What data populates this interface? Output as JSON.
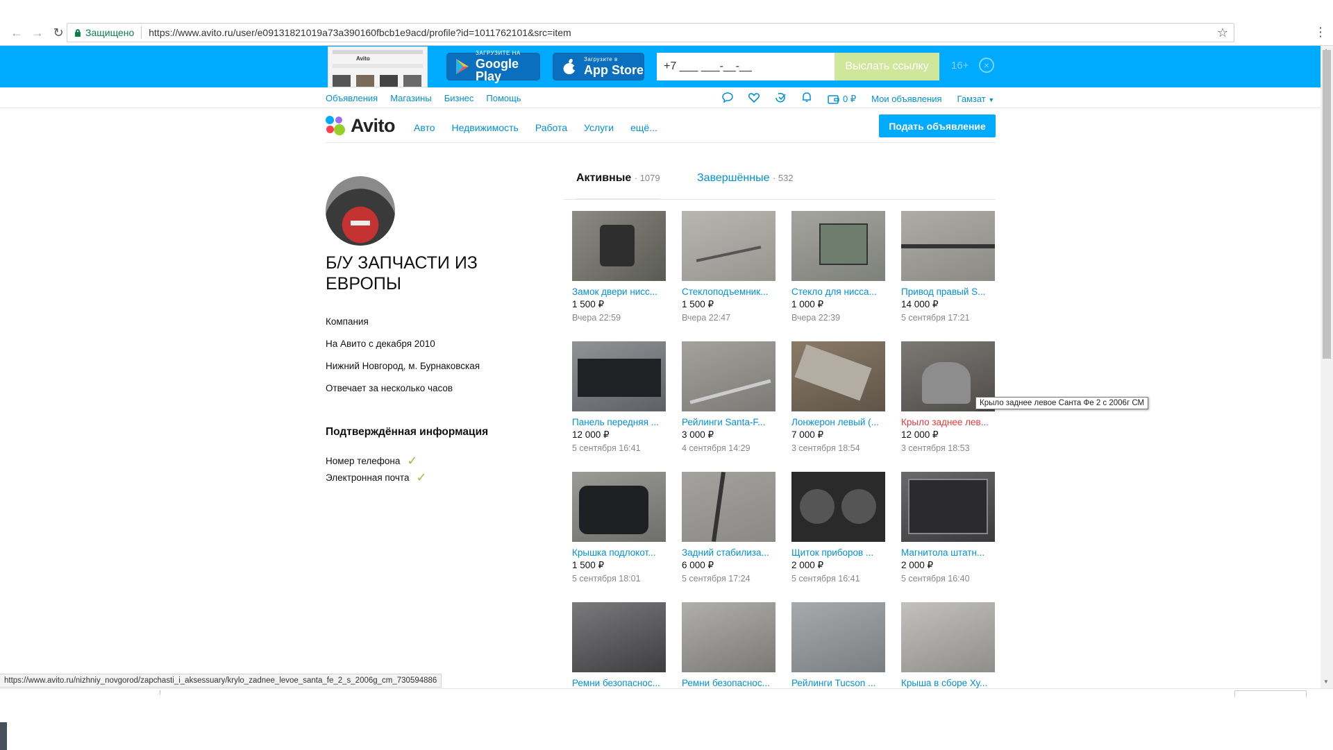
{
  "browser": {
    "secure_label": "Защищено",
    "url": "https://www.avito.ru/user/e09131821019a73a390160fbcb1e9acd/profile?id=1011762101&src=item",
    "status_url": "https://www.avito.ru/nizhniy_novgorod/zapchasti_i_aksessuary/krylo_zadnee_levoe_santa_fe_2_s_2006g_cm_730594886"
  },
  "banner": {
    "google_play_small": "ЗАГРУЗИТЕ НА",
    "google_play_big": "Google Play",
    "app_store_small": "Загрузите в",
    "app_store_big": "App Store",
    "phone_value": "+7 ___ ___-__-__",
    "send_label": "Выслать ссылку",
    "age_label": "16+",
    "mini_logo": "Avito"
  },
  "top_links": [
    "Объявления",
    "Магазины",
    "Бизнес",
    "Помощь"
  ],
  "user_nav": {
    "wallet_value": "0 ₽",
    "my_ads": "Мои объявления",
    "username": "Гамзат"
  },
  "logo_text": "Avito",
  "categories": [
    "Авто",
    "Недвижимость",
    "Работа",
    "Услуги",
    "ещё..."
  ],
  "post_button": "Подать объявление",
  "profile": {
    "name": "Б/У ЗАПЧАСТИ ИЗ ЕВРОПЫ",
    "type": "Компания",
    "since": "На Авито с декабря 2010",
    "location": "Нижний Новгород, м. Бурнаковская",
    "response": "Отвечает за несколько часов",
    "verified_title": "Подтверждённая информация",
    "verified_items": [
      "Номер телефона",
      "Электронная почта"
    ]
  },
  "tabs": {
    "active_label": "Активные",
    "active_count": "· 1079",
    "done_label": "Завершённые",
    "done_count": "· 532"
  },
  "tooltip": "Крыло заднее левое Санта Фе 2 с 2006г СМ",
  "items": [
    {
      "title": "Замок двери нисс...",
      "price": "1 500 ₽",
      "time": "Вчера 22:59",
      "color": "#7a7a72"
    },
    {
      "title": "Стеклоподъемник...",
      "price": "1 500 ₽",
      "time": "Вчера 22:47",
      "color": "#a9a7a1"
    },
    {
      "title": "Стекло для нисса...",
      "price": "1 000 ₽",
      "time": "Вчера 22:39",
      "color": "#8d938c"
    },
    {
      "title": "Привод правый S...",
      "price": "14 000 ₽",
      "time": "5 сентября 17:21",
      "color": "#9c9a94"
    },
    {
      "title": "Панель передняя ...",
      "price": "12 000 ₽",
      "time": "5 сентября 16:41",
      "color": "#4b4d50"
    },
    {
      "title": "Рейлинги Santa-F...",
      "price": "3 000 ₽",
      "time": "4 сентября 14:29",
      "color": "#8f8e8a"
    },
    {
      "title": "Лонжерон левый (...",
      "price": "7 000 ₽",
      "time": "3 сентября 18:54",
      "color": "#8a7b66"
    },
    {
      "title": "Крыло заднее лев...",
      "price": "12 000 ₽",
      "time": "3 сентября 18:53",
      "color": "#6f6c68"
    },
    {
      "title": "Крышка подлокот...",
      "price": "1 500 ₽",
      "time": "5 сентября 18:01",
      "color": "#2d2f33"
    },
    {
      "title": "Задний стабилиза...",
      "price": "6 000 ₽",
      "time": "5 сентября 17:24",
      "color": "#9a9994"
    },
    {
      "title": "Щиток приборов ...",
      "price": "2 000 ₽",
      "time": "5 сентября 16:41",
      "color": "#3a3a3a"
    },
    {
      "title": "Магнитола штатн...",
      "price": "2 000 ₽",
      "time": "5 сентября 16:40",
      "color": "#505052"
    },
    {
      "title": "Ремни безопаснос...",
      "price": "",
      "time": "",
      "color": "#4a4a4c"
    },
    {
      "title": "Ремни безопаснос...",
      "price": "",
      "time": "",
      "color": "#8c8a86"
    },
    {
      "title": "Рейлинги Tucson ...",
      "price": "",
      "time": "",
      "color": "#9c9fa2"
    },
    {
      "title": "Крыша в сборе Ху...",
      "price": "",
      "time": "",
      "color": "#a6a5a2"
    }
  ]
}
